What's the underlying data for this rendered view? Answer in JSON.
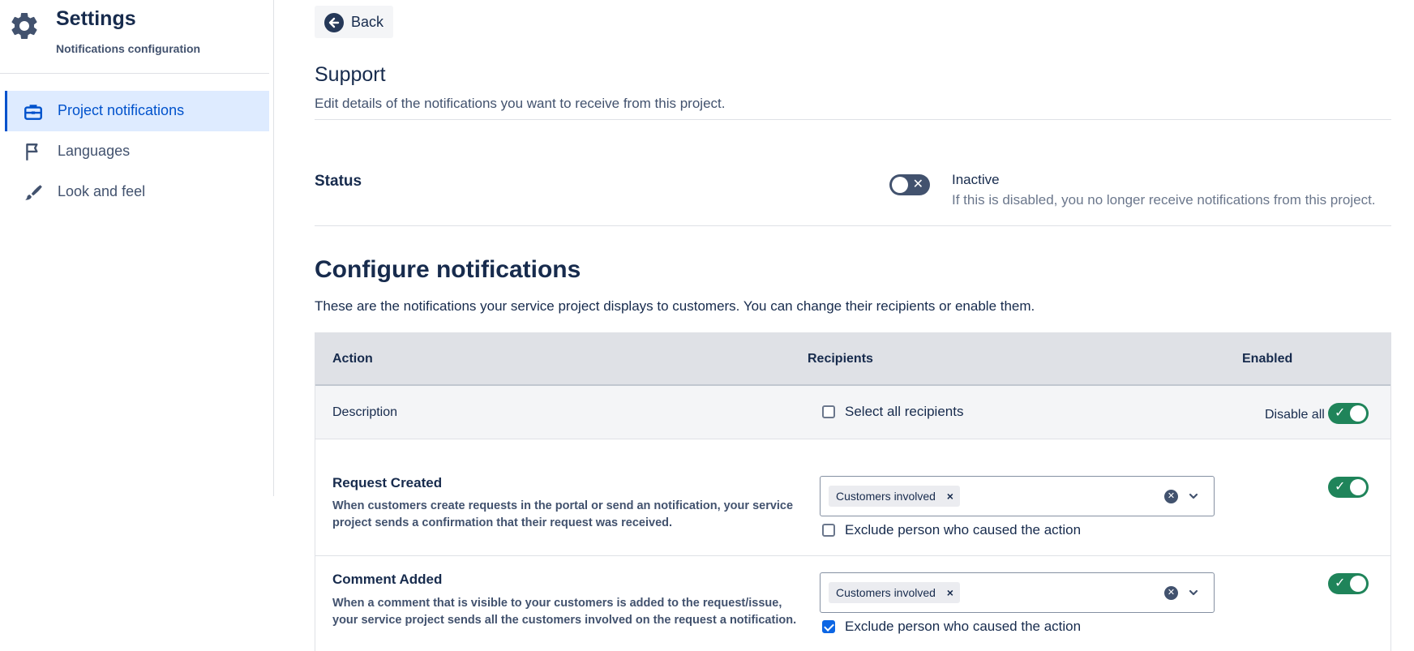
{
  "sidebar": {
    "title": "Settings",
    "subtitle": "Notifications configuration",
    "items": [
      {
        "label": "Project notifications",
        "icon": "briefcase-icon",
        "active": true
      },
      {
        "label": "Languages",
        "icon": "flag-icon",
        "active": false
      },
      {
        "label": "Look and feel",
        "icon": "paintbrush-icon",
        "active": false
      }
    ]
  },
  "main": {
    "back_label": "Back",
    "project_title": "Support",
    "project_desc": "Edit details of the notifications you want to receive from this project.",
    "status": {
      "label": "Status",
      "state": "Inactive",
      "description": "If this is disabled, you no longer receive notifications from this project.",
      "enabled": false
    },
    "config": {
      "title": "Configure notifications",
      "description": "These are the notifications your service project displays to customers. You can change their recipients or enable them."
    },
    "table": {
      "headers": {
        "action": "Action",
        "recipients": "Recipients",
        "enabled": "Enabled"
      },
      "desc_row": {
        "label": "Description",
        "select_all": "Select all recipients",
        "disable_all": "Disable all"
      },
      "rows": [
        {
          "title": "Request Created",
          "description": "When customers create requests in the portal or send an notification, your service project sends a confirmation that their request was received.",
          "recipient_tag": "Customers involved",
          "exclude_label": "Exclude person who caused the action",
          "exclude_checked": false,
          "enabled": true
        },
        {
          "title": "Comment Added",
          "description": "When a comment that is visible to your customers is added to the request/issue, your service project sends all the customers involved on the request a notification.",
          "recipient_tag": "Customers involved",
          "exclude_label": "Exclude person who caused the action",
          "exclude_checked": true,
          "enabled": true
        }
      ]
    }
  },
  "colors": {
    "accent": "#0052cc",
    "active_bg": "#deebff",
    "toggle_on": "#1f845a",
    "toggle_off": "#42526e"
  }
}
